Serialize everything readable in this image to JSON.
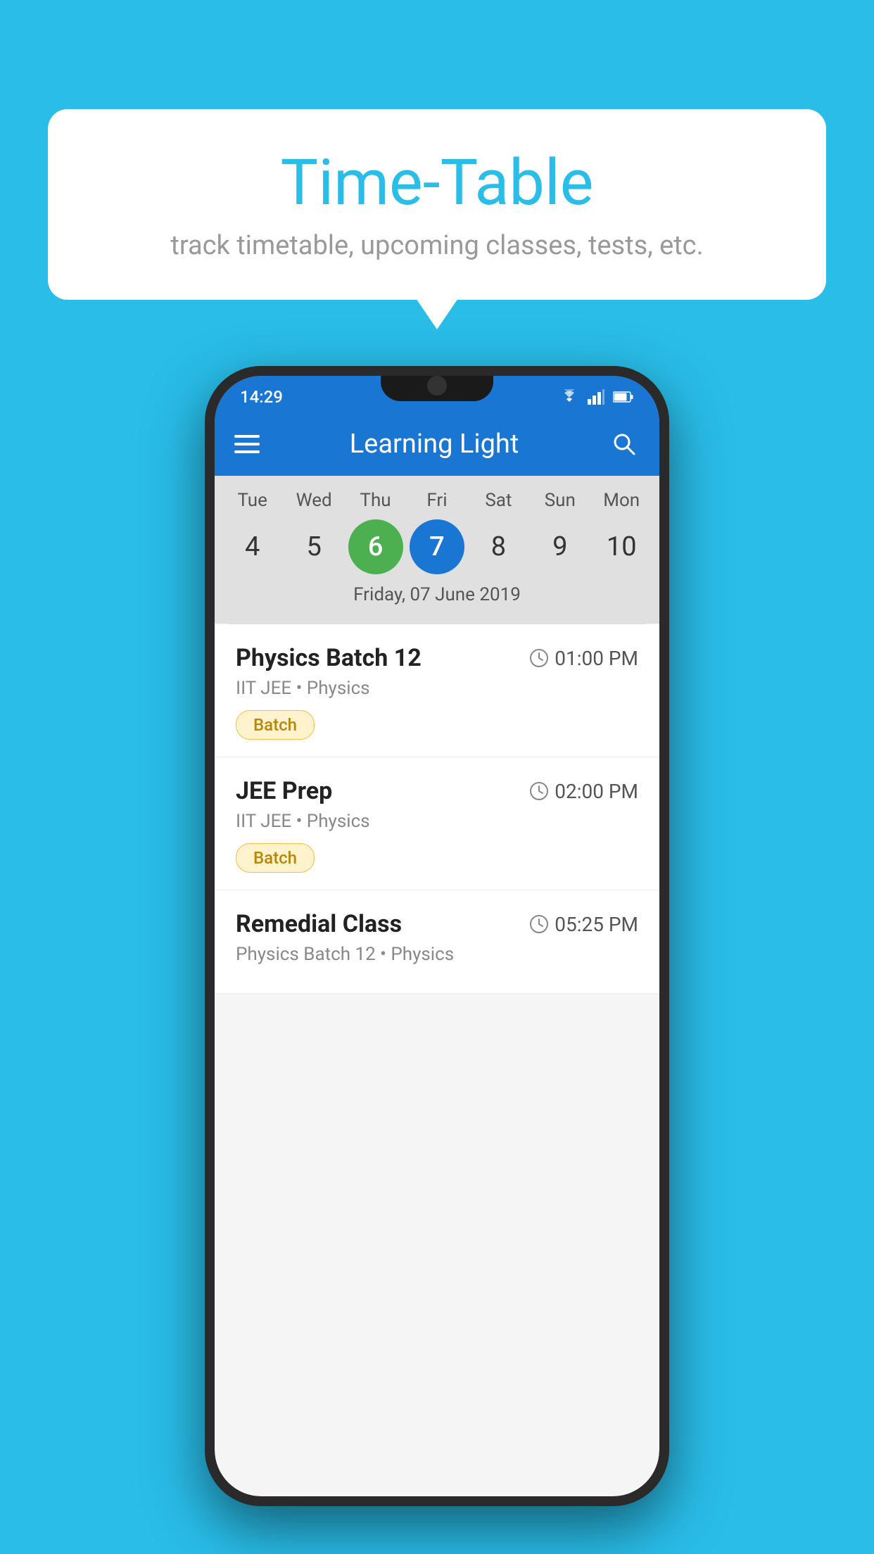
{
  "background_color": "#29bde8",
  "speech_bubble": {
    "title": "Time-Table",
    "subtitle": "track timetable, upcoming classes, tests, etc."
  },
  "phone": {
    "status_bar": {
      "time": "14:29"
    },
    "app_bar": {
      "title": "Learning Light"
    },
    "calendar": {
      "days": [
        {
          "name": "Tue",
          "num": "4",
          "state": "normal"
        },
        {
          "name": "Wed",
          "num": "5",
          "state": "normal"
        },
        {
          "name": "Thu",
          "num": "6",
          "state": "today"
        },
        {
          "name": "Fri",
          "num": "7",
          "state": "selected"
        },
        {
          "name": "Sat",
          "num": "8",
          "state": "normal"
        },
        {
          "name": "Sun",
          "num": "9",
          "state": "normal"
        },
        {
          "name": "Mon",
          "num": "10",
          "state": "normal"
        }
      ],
      "selected_date_label": "Friday, 07 June 2019"
    },
    "classes": [
      {
        "name": "Physics Batch 12",
        "time": "01:00 PM",
        "subject": "IIT JEE • Physics",
        "badge": "Batch"
      },
      {
        "name": "JEE Prep",
        "time": "02:00 PM",
        "subject": "IIT JEE • Physics",
        "badge": "Batch"
      },
      {
        "name": "Remedial Class",
        "time": "05:25 PM",
        "subject": "Physics Batch 12 • Physics",
        "badge": ""
      }
    ]
  }
}
